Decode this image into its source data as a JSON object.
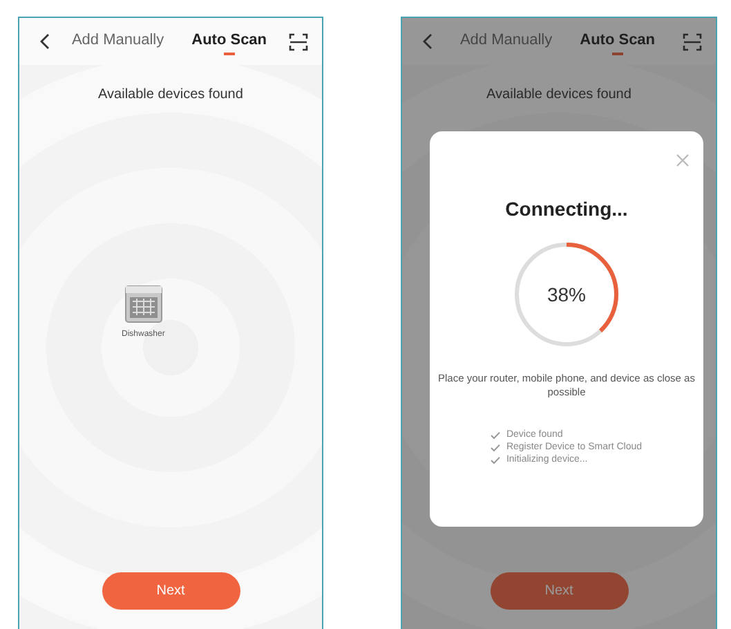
{
  "screens": [
    {
      "tabs": [
        {
          "label": "Add Manually",
          "selected": false
        },
        {
          "label": "Auto Scan",
          "selected": true
        }
      ],
      "heading": "Available devices found",
      "devices": [
        {
          "name": "Dishwasher"
        }
      ],
      "next_button": "Next"
    },
    {
      "tabs": [
        {
          "label": "Add Manually",
          "selected": false
        },
        {
          "label": "Auto Scan",
          "selected": true
        }
      ],
      "heading": "Available devices found",
      "next_button": "Next",
      "dialog": {
        "title": "Connecting...",
        "level": 0.38,
        "percent": "38%",
        "message": "Place your router, mobile phone, and device as close as possible",
        "steps": [
          {
            "label": "Device found",
            "done": true
          },
          {
            "label": "Register Device to Smart Cloud",
            "done": true
          },
          {
            "label": "Initializing device...",
            "done": true
          }
        ]
      }
    }
  ]
}
